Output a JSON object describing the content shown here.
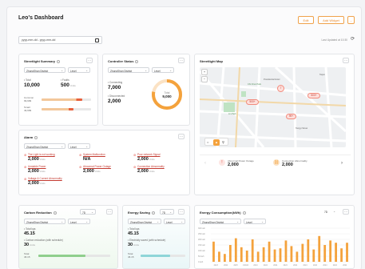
{
  "header": {
    "title": "Leo's Dashboard",
    "edit_label": "Edit",
    "add_widget_label": "Add Widget",
    "more_label": "..."
  },
  "toolbar": {
    "date_range": "yyyy-mm-dd - yyyy-mm-dd",
    "last_updated": "Last Updated at 10:30"
  },
  "streetlight_summary": {
    "title": "Streetlight Summary",
    "district": "ZhongShan District",
    "level": "Level",
    "total_label": "• Total",
    "total_value": "10,000",
    "faults_label": "• Faults",
    "faults_value": "500",
    "unit": "Units",
    "rows": [
      {
        "label": "Common",
        "sub": "99,999",
        "fill": 0.82,
        "color": "#f3c79a",
        "accent": "#e8603c"
      },
      {
        "label": "Smart",
        "sub": "49,999",
        "fill": 0.65,
        "color": "#f3c79a",
        "accent": "#e8603c"
      }
    ]
  },
  "controller_status": {
    "title": "Controller Status",
    "district": "ZhongShan District",
    "level": "Level",
    "connecting_label": "• Connecting",
    "connecting_value": "7,000",
    "disconnected_label": "• Disconnected",
    "disconnected_value": "2,000",
    "donut_label": "Total",
    "donut_value": "9,000",
    "connected_ratio": 0.78,
    "colors": {
      "connected": "#f4a23c",
      "disconnected": "#fbe2c4"
    }
  },
  "streetlight_map": {
    "title": "Streetlight Map",
    "markers": [
      {
        "label": "500+"
      },
      {
        "label": "500+"
      },
      {
        "label": "99+"
      },
      {
        "label": "7"
      }
    ],
    "places": [
      "Lin Park",
      "Presidential Hotel",
      "Chi Chun Park",
      "Tangyi Street",
      "Taipei"
    ],
    "legend": [
      {
        "label": "Abnormal Power Outage",
        "value": "2,000",
        "icon": "warning-icon"
      },
      {
        "label": "Connection Abnormality",
        "value": "2,000",
        "icon": "unlink-icon"
      }
    ]
  },
  "alarm": {
    "title": "Alarm",
    "district": "ZhongShan District",
    "level": "Level",
    "items": [
      {
        "label": "The Light is not working",
        "value": "2,000",
        "unit": "Units"
      },
      {
        "label": "System Malfunction",
        "value": "N/A",
        "unit": ""
      },
      {
        "label": "Poor network Signal",
        "value": "2,000",
        "unit": "Units"
      },
      {
        "label": "Unstable Power",
        "value": "2,000",
        "unit": "Units"
      },
      {
        "label": "Abnormal Power Outage",
        "value": "2,000",
        "unit": "Units"
      },
      {
        "label": "Connection Abnormality",
        "value": "2,000",
        "unit": "Units"
      },
      {
        "label": "Voltage & Current Abnormality",
        "value": "2,000",
        "unit": "Units"
      }
    ]
  },
  "carbon_reduction": {
    "title": "Carbon Reduction",
    "district": "ZhongShan District",
    "level": "Level",
    "period": "7D",
    "toggle_label": "Kg",
    "total_label": "• Total kgs",
    "total_value": "45.15",
    "compare_label": "• Carbon reduction (with schedule)",
    "compare_value": "30",
    "compare_unit": "Units",
    "total_small": "Total",
    "total_small_value": "46.15",
    "bar_fill": 0.66
  },
  "energy_saving": {
    "title": "Energy Saving",
    "district": "ZhongShan District",
    "level": "Level",
    "period": "7D",
    "toggle_label": "kWh",
    "total_label": "• Total kgs",
    "total_value": "45.15",
    "compare_label": "• Electricity saved (with schedule)",
    "compare_value": "30",
    "compare_unit": "Units",
    "total_small": "Total",
    "total_small_value": "46.15",
    "bar_fill": 0.66
  },
  "energy_consumption": {
    "title": "Energy Consumption(kWh)",
    "district": "ZhongShan District",
    "level": "Level",
    "period": "7D"
  },
  "chart_data": {
    "type": "bar",
    "categories": [
      "Jan",
      "Feb",
      "Mar",
      "Apr",
      "May",
      "Jun",
      "Jul",
      "Aug",
      "Sep",
      "Oct",
      "Nov",
      "Dec",
      "Jan",
      "Feb",
      "Mar",
      "Apr",
      "May",
      "Jun",
      "Jul",
      "Aug",
      "Sep",
      "Oct",
      "Nov",
      "Dec",
      "Jan"
    ],
    "values": [
      180,
      90,
      70,
      150,
      210,
      130,
      100,
      200,
      90,
      130,
      180,
      110,
      120,
      190,
      140,
      90,
      160,
      200,
      110,
      230,
      150,
      190,
      170,
      120,
      170
    ],
    "ylim": [
      0,
      300
    ],
    "yticks": [
      "300 kwh",
      "250 kwh",
      "200 kwh",
      "150 kwh",
      "100 kwh",
      "50 kwh",
      "0 kwh"
    ],
    "xticks": [
      "2023",
      "2024",
      "2025",
      "1/2024",
      "2024",
      "2024",
      "2024",
      "2024",
      "2024",
      "2024",
      "2024",
      "2024",
      "2024",
      "2024"
    ],
    "color": "#f4a23c"
  }
}
